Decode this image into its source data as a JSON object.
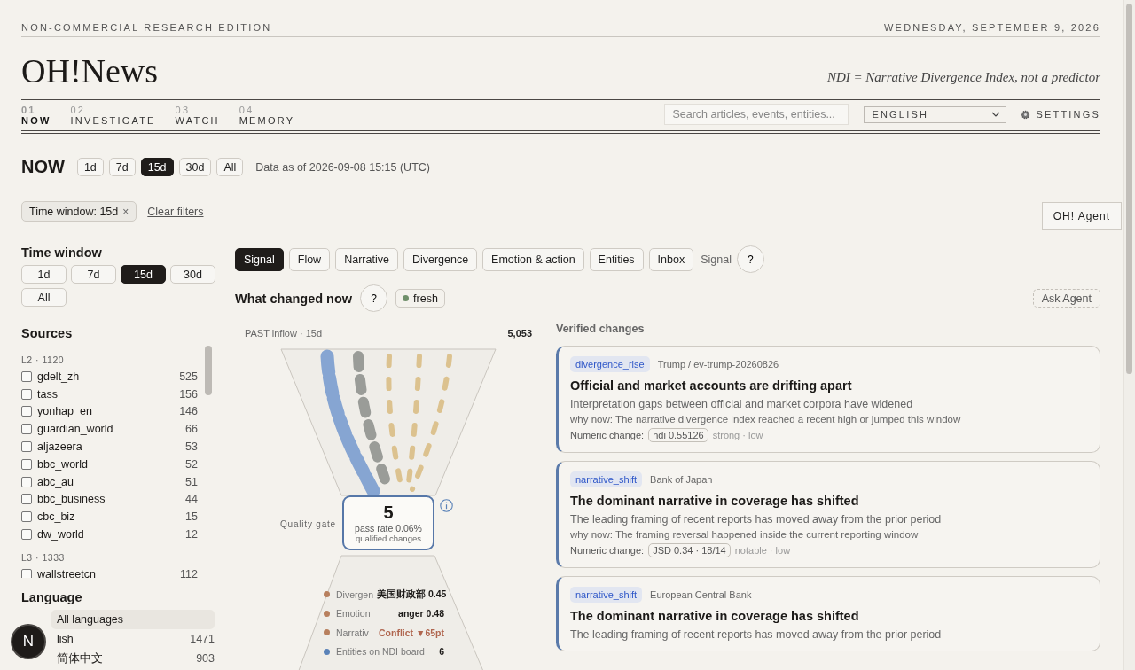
{
  "edition": "NON-COMMERCIAL RESEARCH EDITION",
  "date": "WEDNESDAY, SEPTEMBER 9, 2026",
  "logo": "OH!News",
  "tagline": "NDI = Narrative Divergence Index, not a predictor",
  "nav": [
    {
      "number": "01",
      "label": "NOW",
      "selected": true
    },
    {
      "number": "02",
      "label": "INVESTIGATE",
      "selected": false
    },
    {
      "number": "03",
      "label": "WATCH",
      "selected": false
    },
    {
      "number": "04",
      "label": "MEMORY",
      "selected": false
    }
  ],
  "search": {
    "placeholder": "Search articles, events, entities..."
  },
  "language_select": "ENGLISH",
  "settings": "SETTINGS",
  "page_title": "NOW",
  "ranges": [
    {
      "label": "1d",
      "selected": false
    },
    {
      "label": "7d",
      "selected": false
    },
    {
      "label": "15d",
      "selected": true
    },
    {
      "label": "30d",
      "selected": false
    },
    {
      "label": "All",
      "selected": false
    }
  ],
  "data_as_of": "Data as of 2026-09-08 15:15 (UTC)",
  "filter_chip": {
    "label": "Time window: 15d",
    "close": "×"
  },
  "clear_filters": "Clear filters",
  "agent_button": "OH! Agent",
  "sidebar": {
    "time_window": {
      "title": "Time window",
      "options": [
        {
          "label": "1d",
          "selected": false
        },
        {
          "label": "7d",
          "selected": false
        },
        {
          "label": "15d",
          "selected": true
        },
        {
          "label": "30d",
          "selected": false
        },
        {
          "label": "All",
          "selected": false
        }
      ]
    },
    "sources": {
      "title": "Sources",
      "groups": [
        {
          "label": "L2 · 1120",
          "items": [
            {
              "name": "gdelt_zh",
              "count": "525",
              "checked": false
            },
            {
              "name": "tass",
              "count": "156",
              "checked": false
            },
            {
              "name": "yonhap_en",
              "count": "146",
              "checked": false
            },
            {
              "name": "guardian_world",
              "count": "66",
              "checked": false
            },
            {
              "name": "aljazeera",
              "count": "53",
              "checked": false
            },
            {
              "name": "bbc_world",
              "count": "52",
              "checked": false
            },
            {
              "name": "abc_au",
              "count": "51",
              "checked": false
            },
            {
              "name": "bbc_business",
              "count": "44",
              "checked": false
            },
            {
              "name": "cbc_biz",
              "count": "15",
              "checked": false
            },
            {
              "name": "dw_world",
              "count": "12",
              "checked": false
            }
          ]
        },
        {
          "label": "L3 · 1333",
          "items": [
            {
              "name": "wallstreetcn",
              "count": "112",
              "checked": false
            }
          ]
        }
      ]
    },
    "language": {
      "title": "Language",
      "items": [
        {
          "label": "All languages",
          "selected": true
        },
        {
          "label": "lish",
          "count": "1471",
          "selected": false
        },
        {
          "label": "简体中文",
          "count": "903",
          "selected": false
        }
      ]
    }
  },
  "avatar": "N",
  "tabs": [
    {
      "label": "Signal",
      "selected": true
    },
    {
      "label": "Flow",
      "selected": false
    },
    {
      "label": "Narrative",
      "selected": false
    },
    {
      "label": "Divergence",
      "selected": false
    },
    {
      "label": "Emotion & action",
      "selected": false
    },
    {
      "label": "Entities",
      "selected": false
    },
    {
      "label": "Inbox",
      "selected": false
    }
  ],
  "tabs_caption": "Signal",
  "help": "?",
  "section_title": "What changed now",
  "freshness": "fresh",
  "ask_agent": "Ask Agent",
  "funnel": {
    "inflow_label": "PAST inflow · 15d",
    "inflow_count": "5,053",
    "gate_label": "Quality gate",
    "gate_count": "5",
    "pass_rate": "pass rate 0.06%",
    "gate_caption": "qualified changes",
    "legend": [
      {
        "label": "Divergen",
        "value": "美国财政部 0.45",
        "color": "#b8805e",
        "highlight": false
      },
      {
        "label": "Emotion",
        "value": "anger 0.48",
        "color": "#b8805e",
        "highlight": false
      },
      {
        "label": "Narrativ",
        "value": "Conflict ▼65pt",
        "color": "#b8805e",
        "highlight": true
      },
      {
        "label": "Entities on NDI board",
        "value": "6",
        "color": "#5a82b8",
        "highlight": false
      }
    ]
  },
  "changes": {
    "title": "Verified changes",
    "cards": [
      {
        "tag": "divergence_rise",
        "source": "Trump / ev-trump-20260826",
        "title": "Official and market accounts are drifting apart",
        "summary": "Interpretation gaps between official and market corpora have widened",
        "why_now": "why now: The narrative divergence index reached a recent high or jumped this window",
        "numeric_label": "Numeric change:",
        "numeric_value": "ndi 0.55126",
        "strength": "strong · low"
      },
      {
        "tag": "narrative_shift",
        "source": "Bank of Japan",
        "title": "The dominant narrative in coverage has shifted",
        "summary": "The leading framing of recent reports has moved away from the prior period",
        "why_now": "why now: The framing reversal happened inside the current reporting window",
        "numeric_label": "Numeric change:",
        "numeric_value": "JSD 0.34 · 18/14",
        "strength": "notable · low"
      },
      {
        "tag": "narrative_shift",
        "source": "European Central Bank",
        "title": "The dominant narrative in coverage has shifted",
        "summary": "The leading framing of recent reports has moved away from the prior period"
      }
    ]
  }
}
